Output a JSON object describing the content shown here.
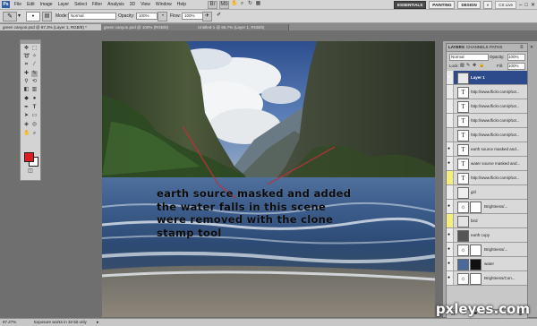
{
  "app": {
    "logo": "Ps",
    "menus": [
      "File",
      "Edit",
      "Image",
      "Layer",
      "Select",
      "Filter",
      "Analysis",
      "3D",
      "View",
      "Window",
      "Help"
    ],
    "workspaces": [
      "ESSENTIALS",
      "PAINTING",
      "DESIGN"
    ],
    "active_workspace": "ESSENTIALS",
    "more_workspaces": "»",
    "cs_live": "CS Live"
  },
  "options": {
    "mode_label": "Mode:",
    "mode_value": "Normal",
    "opacity_label": "Opacity:",
    "opacity_value": "100%",
    "flow_label": "Flow:",
    "flow_value": "100%"
  },
  "tabs": [
    "green canyon.psd @ 87.3% (Layer 1, RGB/8) *",
    "green canyon.psd @ 100% (RGB/8)",
    "Untitled-1 @ 66.7% (Layer 1, RGB/8)"
  ],
  "layers_panel": {
    "tabs": [
      "LAYERS",
      "CHANNELS",
      "PATHS"
    ],
    "blend_mode": "Normal",
    "opacity_label": "Opacity:",
    "opacity_value": "100%",
    "lock_label": "Lock:",
    "fill_label": "Fill:",
    "fill_value": "100%",
    "layers": [
      {
        "name": "Layer 1",
        "selected": true,
        "thumb": ""
      },
      {
        "name": "http://www.flickr.com/phot...",
        "thumb": "T"
      },
      {
        "name": "http://www.flickr.com/phot...",
        "thumb": "T"
      },
      {
        "name": "http://www.flickr.com/phot...",
        "thumb": "T"
      },
      {
        "name": "http://www.flickr.com/phot...",
        "thumb": "T"
      },
      {
        "name": "earth source masked and...",
        "thumb": "T"
      },
      {
        "name": "water source masked and...",
        "thumb": "T"
      },
      {
        "name": "http://www.flickr.com/phot...",
        "thumb": "T"
      },
      {
        "name": "girl",
        "thumb": ""
      },
      {
        "name": "Brightness/...",
        "thumb": "☼"
      },
      {
        "name": "bird",
        "thumb": ""
      },
      {
        "name": "earth copy",
        "thumb": ""
      },
      {
        "name": "Brightness/...",
        "thumb": "☼"
      },
      {
        "name": "water",
        "thumb": ""
      },
      {
        "name": "Brightness/Con...",
        "thumb": "☼"
      }
    ]
  },
  "status": {
    "zoom": "87.27%",
    "message": "Exposure works in 32-bit only"
  },
  "canvas_note": [
    "earth source masked and added",
    "the water falls in this scene",
    "were removed with the clone",
    "stamp tool"
  ],
  "watermark": "pxleyes.com",
  "colors": {
    "foreground": "#e11921",
    "background": "#ffffff",
    "selected_layer": "#2d4a8a"
  }
}
